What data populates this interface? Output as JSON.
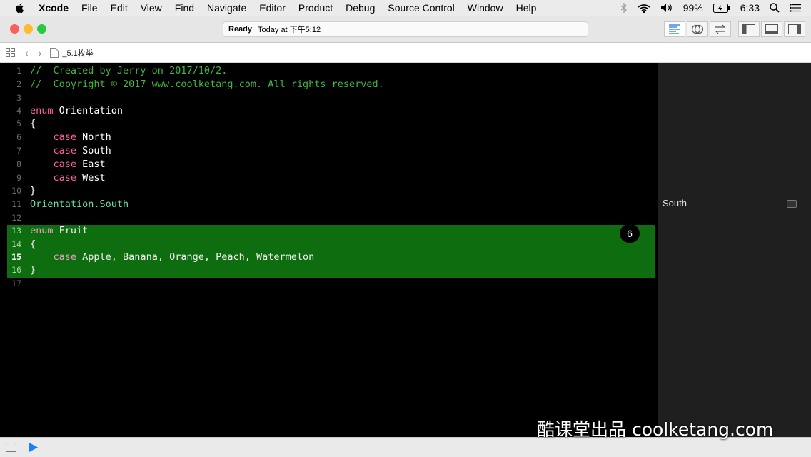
{
  "menubar": {
    "app": "Xcode",
    "items": [
      "File",
      "Edit",
      "View",
      "Find",
      "Navigate",
      "Editor",
      "Product",
      "Debug",
      "Source Control",
      "Window",
      "Help"
    ],
    "battery": "99%",
    "time": "6:33"
  },
  "toolbar": {
    "status": "Ready",
    "time": "Today at 下午5:12"
  },
  "jumpbar": {
    "file": "_5.1枚举"
  },
  "editor": {
    "lines": [
      "1",
      "2",
      "3",
      "4",
      "5",
      "6",
      "7",
      "8",
      "9",
      "10",
      "11",
      "12",
      "13",
      "14",
      "15",
      "16",
      "17"
    ],
    "code": {
      "l1": "//  Created by Jerry on 2017/10/2.",
      "l2": "//  Copyright © 2017 www.coolketang.com. All rights reserved.",
      "l4_kw": "enum",
      "l4_name": " Orientation",
      "l5": "{",
      "l6_kw": "case",
      "l6_name": " North",
      "l7_kw": "case",
      "l7_name": " South",
      "l8_kw": "case",
      "l8_name": " East",
      "l9_kw": "case",
      "l9_name": " West",
      "l10": "}",
      "l11_type": "Orientation",
      "l11_member": ".South",
      "l13_kw": "enum",
      "l13_name": " Fruit",
      "l14": "{",
      "l15_kw": "case",
      "l15_name": " Apple, Banana, Orange, Peach, Watermelon",
      "l16": "}"
    },
    "badge": "6"
  },
  "results": {
    "line11": "South"
  },
  "watermark": "酷课堂出品 coolketang.com"
}
